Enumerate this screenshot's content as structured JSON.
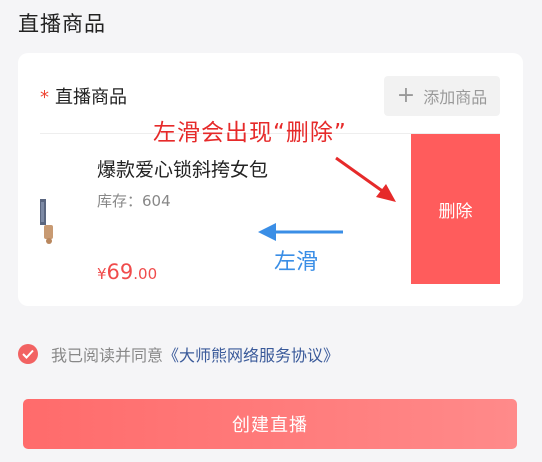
{
  "section": {
    "title": "直播商品"
  },
  "card": {
    "required_mark": "*",
    "field_label": "直播商品",
    "add_button": {
      "icon": "plus-icon",
      "label": "添加商品"
    },
    "product": {
      "name": "爆款爱心锁斜挎女包",
      "stock": "库存：604",
      "price_symbol": "¥",
      "price_int": "69",
      "price_dec": ".00"
    },
    "delete_label": "删除"
  },
  "annotations": {
    "top": "左滑会出现“删除”",
    "left": "左滑",
    "top_color": "#e62a2a",
    "left_color": "#3a8ee6"
  },
  "agreement": {
    "prefix": "我已阅读并同意",
    "link": "《大师熊网络服务协议》",
    "checked": true
  },
  "create_button": {
    "label": "创建直播"
  },
  "colors": {
    "accent": "#ff5c5c",
    "price": "#f04b4b"
  }
}
